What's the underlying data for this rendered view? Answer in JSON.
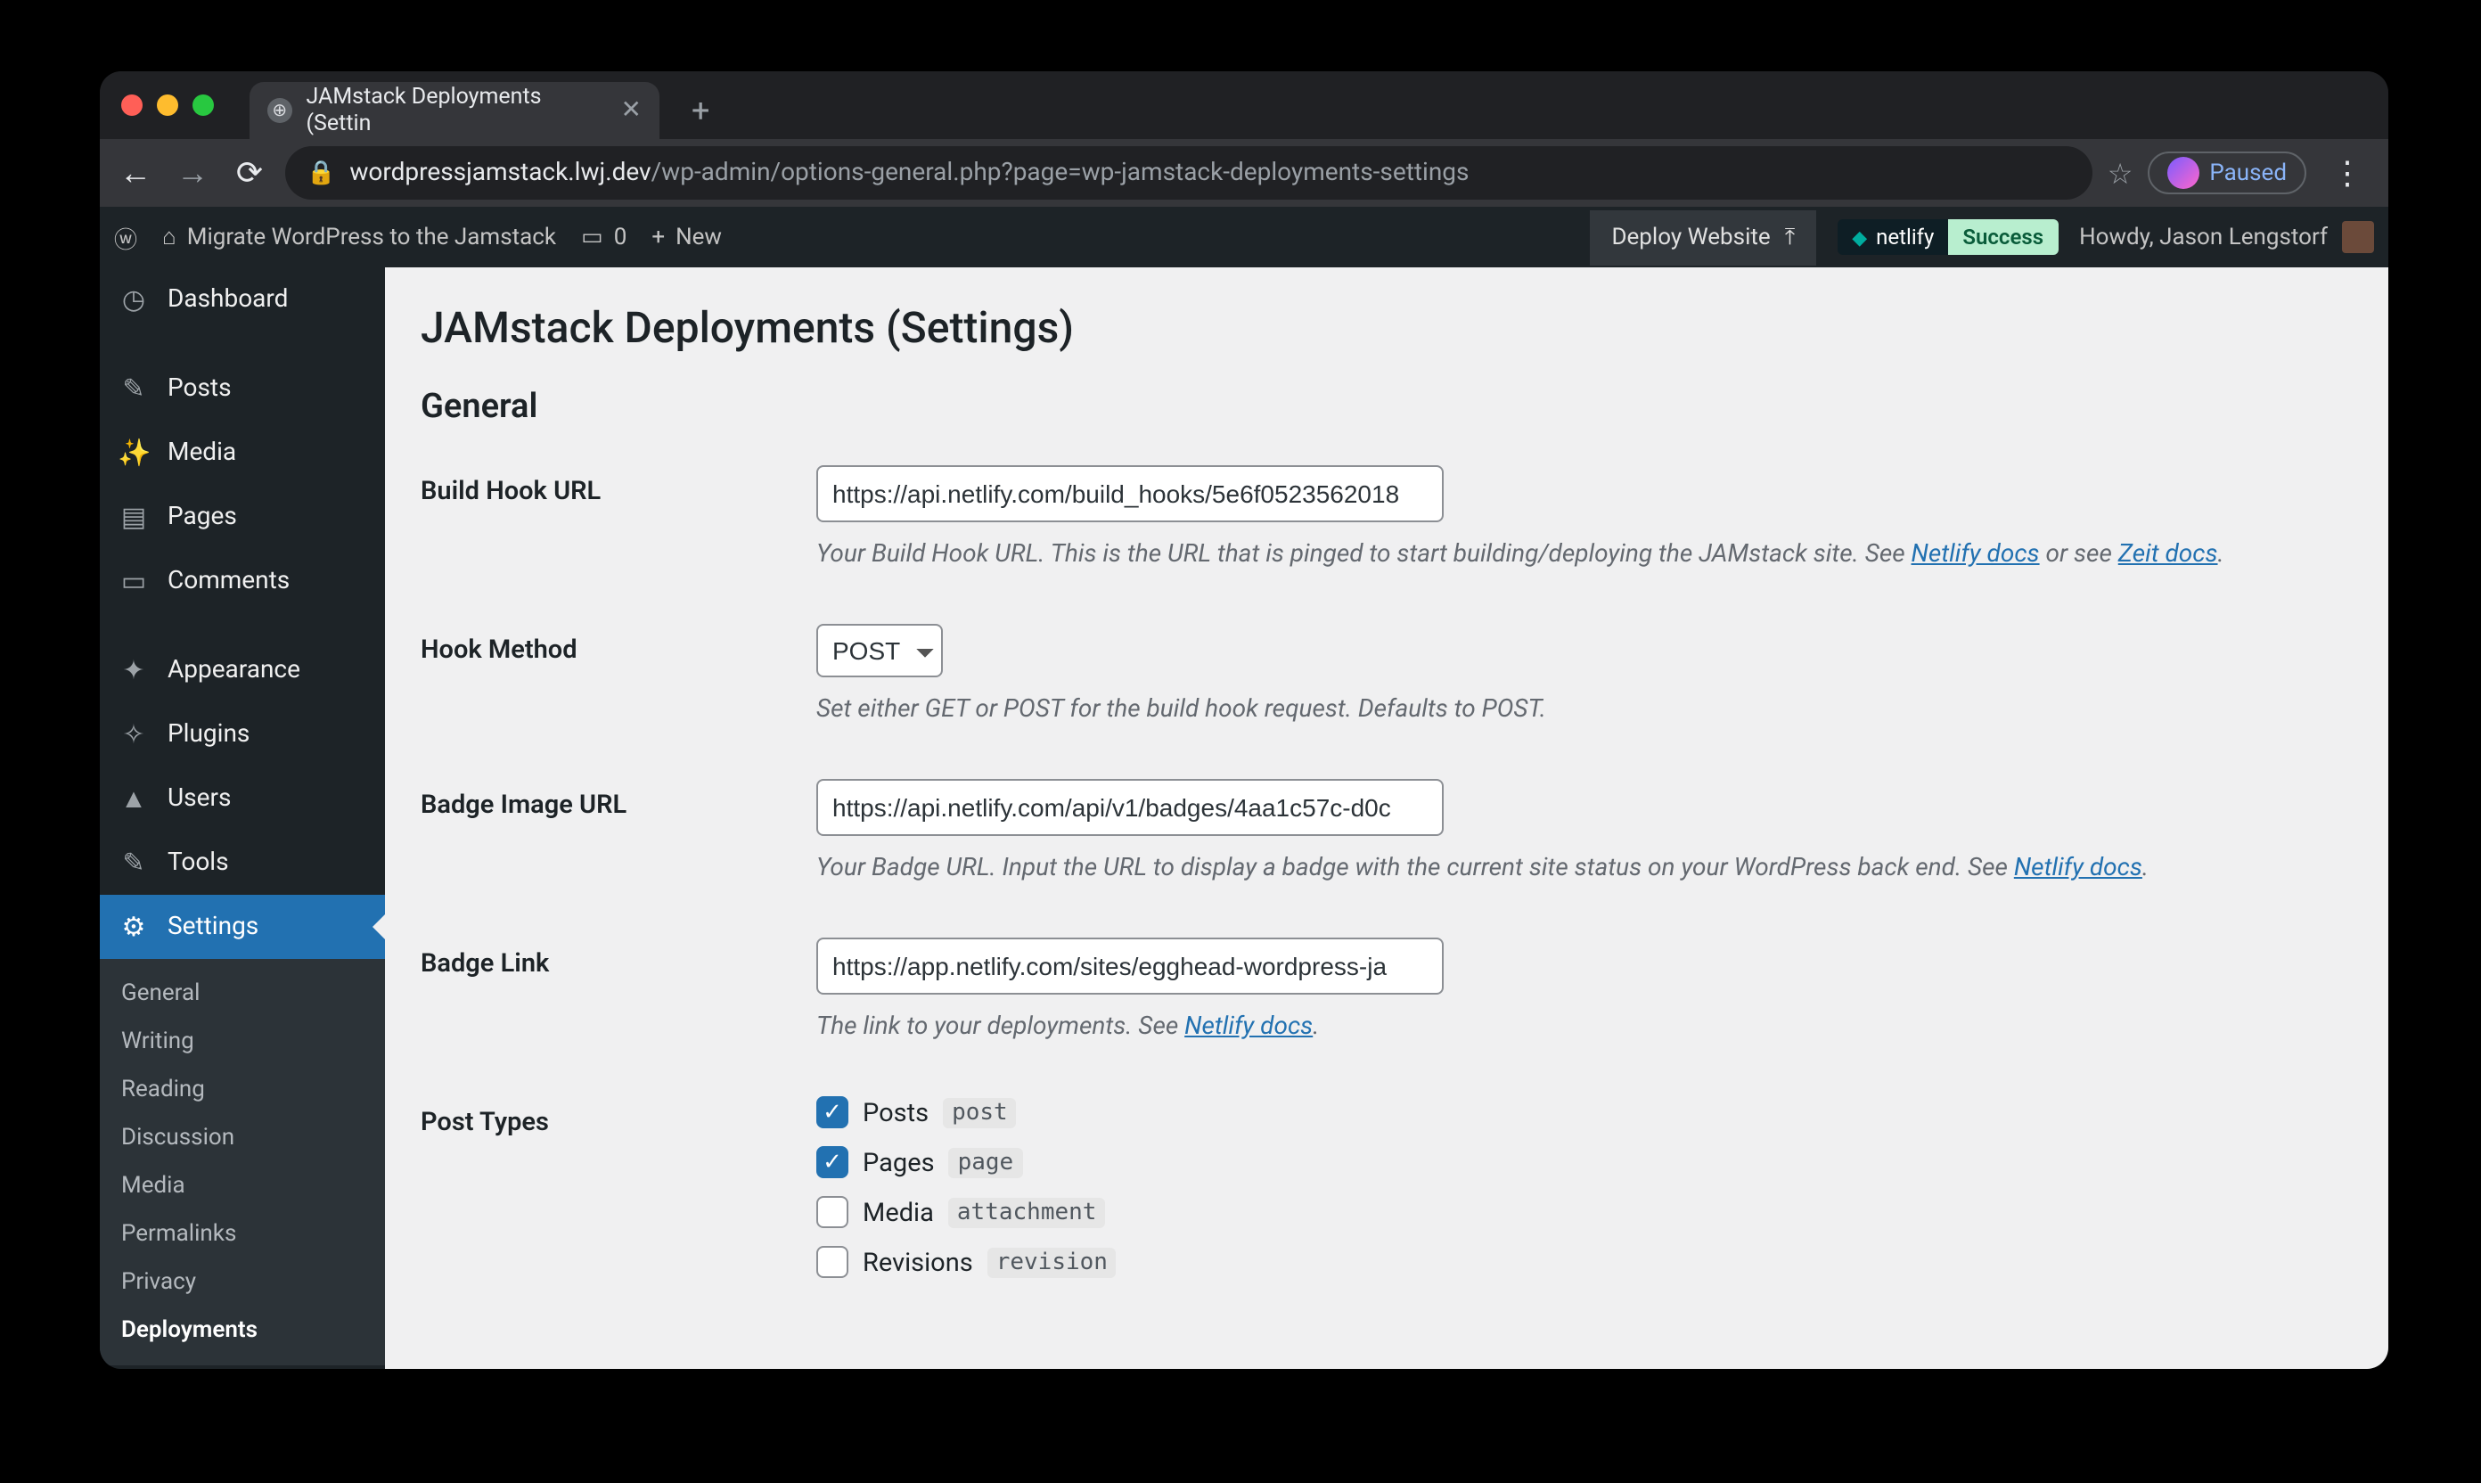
{
  "browser": {
    "tab_title": "JAMstack Deployments (Settin",
    "url_host": "wordpressjamstack.lwj.dev",
    "url_path": "/wp-admin/options-general.php?page=wp-jamstack-deployments-settings",
    "paused_label": "Paused"
  },
  "wpbar": {
    "site_title": "Migrate WordPress to the Jamstack",
    "comments_count": "0",
    "new_label": "New",
    "deploy_label": "Deploy Website",
    "netlify_brand": "netlify",
    "netlify_status": "Success",
    "howdy": "Howdy, Jason Lengstorf"
  },
  "sidebar": {
    "items": [
      {
        "icon": "◷",
        "label": "Dashboard"
      },
      {
        "icon": "✎",
        "label": "Posts"
      },
      {
        "icon": "✨",
        "label": "Media"
      },
      {
        "icon": "▤",
        "label": "Pages"
      },
      {
        "icon": "▭",
        "label": "Comments"
      },
      {
        "icon": "✦",
        "label": "Appearance"
      },
      {
        "icon": "✧",
        "label": "Plugins"
      },
      {
        "icon": "▲",
        "label": "Users"
      },
      {
        "icon": "✎",
        "label": "Tools"
      },
      {
        "icon": "⚙",
        "label": "Settings"
      }
    ],
    "submenu": [
      "General",
      "Writing",
      "Reading",
      "Discussion",
      "Media",
      "Permalinks",
      "Privacy",
      "Deployments"
    ]
  },
  "page": {
    "title": "JAMstack Deployments (Settings)",
    "section_general": "General",
    "fields": {
      "build_hook": {
        "label": "Build Hook URL",
        "value": "https://api.netlify.com/build_hooks/5e6f0523562018",
        "desc_pre": "Your Build Hook URL. This is the URL that is pinged to start building/deploying the JAMstack site. See ",
        "link1": "Netlify docs",
        "desc_mid": " or see ",
        "link2": "Zeit docs",
        "desc_end": "."
      },
      "hook_method": {
        "label": "Hook Method",
        "value": "POST",
        "desc": "Set either GET or POST for the build hook request. Defaults to POST."
      },
      "badge_url": {
        "label": "Badge Image URL",
        "value": "https://api.netlify.com/api/v1/badges/4aa1c57c-d0c",
        "desc_pre": "Your Badge URL. Input the URL to display a badge with the current site status on your WordPress back end. See ",
        "link1": "Netlify docs",
        "desc_end": "."
      },
      "badge_link": {
        "label": "Badge Link",
        "value": "https://app.netlify.com/sites/egghead-wordpress-ja",
        "desc_pre": "The link to your deployments. See ",
        "link1": "Netlify docs",
        "desc_end": "."
      },
      "post_types": {
        "label": "Post Types",
        "items": [
          {
            "checked": true,
            "label": "Posts",
            "slug": "post"
          },
          {
            "checked": true,
            "label": "Pages",
            "slug": "page"
          },
          {
            "checked": false,
            "label": "Media",
            "slug": "attachment"
          },
          {
            "checked": false,
            "label": "Revisions",
            "slug": "revision"
          }
        ]
      }
    }
  }
}
